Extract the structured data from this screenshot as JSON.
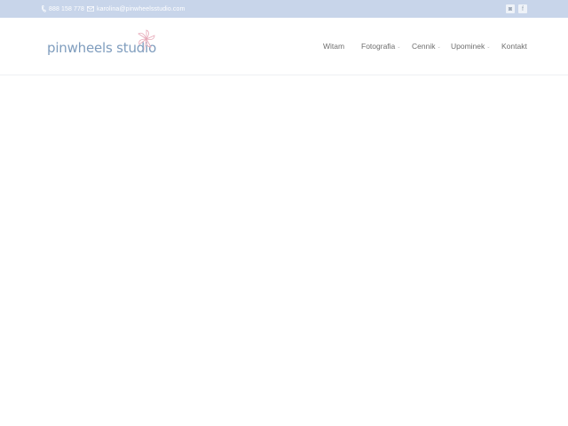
{
  "topbar": {
    "phone": "888 158 778",
    "email": "karolina@pinwheelsstudio.com",
    "social": [
      {
        "name": "instagram",
        "glyph": "◙"
      },
      {
        "name": "facebook",
        "glyph": "f"
      }
    ]
  },
  "header": {
    "logo_text": "pinwheels studio"
  },
  "nav": {
    "items": [
      {
        "label": "Witam",
        "has_dropdown": false
      },
      {
        "label": "Fotografia",
        "has_dropdown": true
      },
      {
        "label": "Cennik",
        "has_dropdown": true
      },
      {
        "label": "Upominek",
        "has_dropdown": true
      },
      {
        "label": "Kontakt",
        "has_dropdown": false
      }
    ],
    "caret": "⌄"
  },
  "colors": {
    "topbar": "#c8d5ea",
    "logo": "#7f9dbe",
    "pinwheel": "#e7a9b8",
    "nav_text": "#6e6e6e"
  }
}
